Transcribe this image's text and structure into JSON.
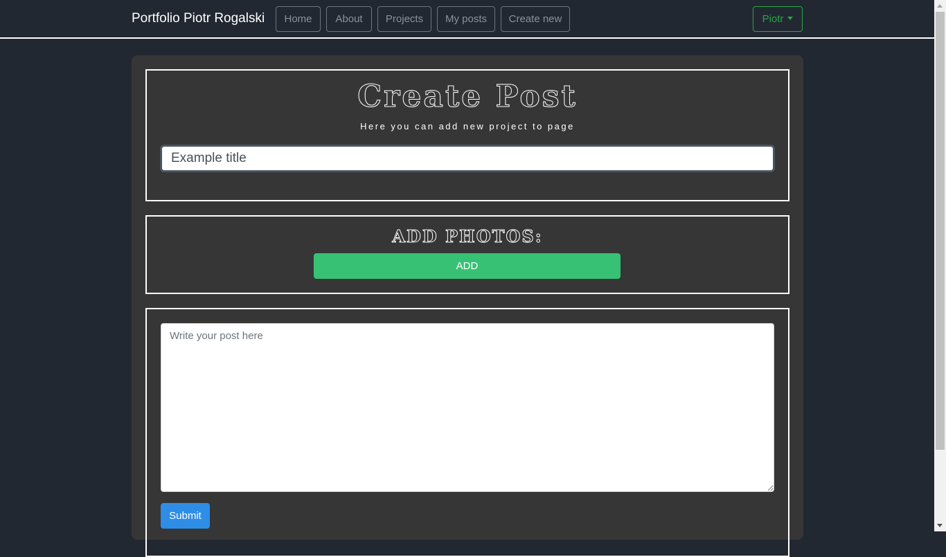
{
  "navbar": {
    "brand": "Portfolio Piotr Rogalski",
    "links": [
      {
        "label": "Home"
      },
      {
        "label": "About"
      },
      {
        "label": "Projects"
      },
      {
        "label": "My posts"
      },
      {
        "label": "Create new"
      }
    ],
    "user_menu": {
      "label": "Piotr"
    }
  },
  "header_section": {
    "title": "Create Post",
    "subtitle": "Here you can add new project to page",
    "title_input": {
      "placeholder": "Example title",
      "value": ""
    }
  },
  "photos_section": {
    "heading": "ADD PHOTOS:",
    "add_label": "ADD"
  },
  "post_section": {
    "textarea": {
      "placeholder": "Write your post here",
      "value": ""
    },
    "submit_label": "Submit"
  },
  "colors": {
    "background": "#222831",
    "panel": "#363636",
    "add_button": "#37c174",
    "submit_button": "#2e8de6",
    "user_menu_border": "#28a745"
  }
}
